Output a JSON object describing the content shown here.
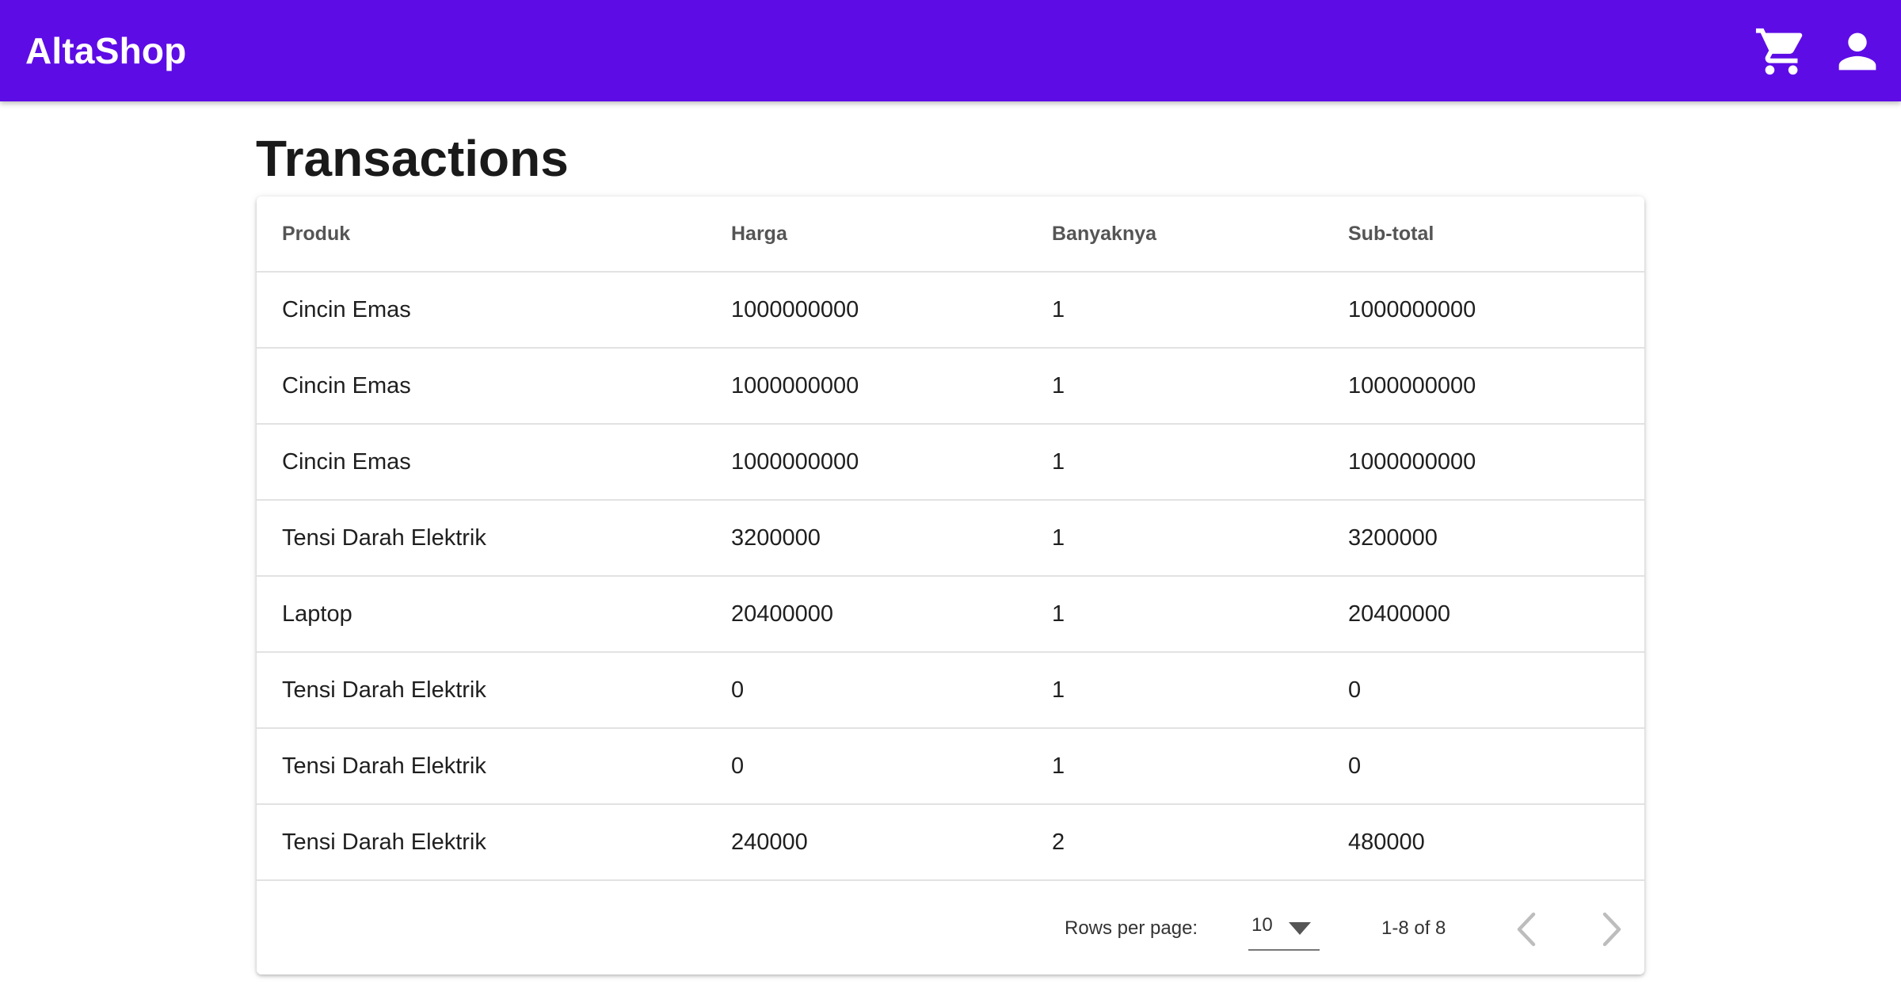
{
  "app": {
    "brand": "AltaShop",
    "accent_color": "#5e0ce6",
    "icons": [
      "shopping-cart-icon",
      "account-icon"
    ]
  },
  "page": {
    "title": "Transactions"
  },
  "table": {
    "columns": [
      "Produk",
      "Harga",
      "Banyaknya",
      "Sub-total"
    ],
    "rows": [
      [
        "Cincin Emas",
        "1000000000",
        "1",
        "1000000000"
      ],
      [
        "Cincin Emas",
        "1000000000",
        "1",
        "1000000000"
      ],
      [
        "Cincin Emas",
        "1000000000",
        "1",
        "1000000000"
      ],
      [
        "Tensi Darah Elektrik",
        "3200000",
        "1",
        "3200000"
      ],
      [
        "Laptop",
        "20400000",
        "1",
        "20400000"
      ],
      [
        "Tensi Darah Elektrik",
        "0",
        "1",
        "0"
      ],
      [
        "Tensi Darah Elektrik",
        "0",
        "1",
        "0"
      ],
      [
        "Tensi Darah Elektrik",
        "240000",
        "2",
        "480000"
      ]
    ]
  },
  "pagination": {
    "rows_per_page_label": "Rows per page:",
    "rows_per_page_value": "10",
    "range": "1-8 of 8",
    "prev_icon": "chevron-left-icon",
    "next_icon": "chevron-right-icon"
  }
}
